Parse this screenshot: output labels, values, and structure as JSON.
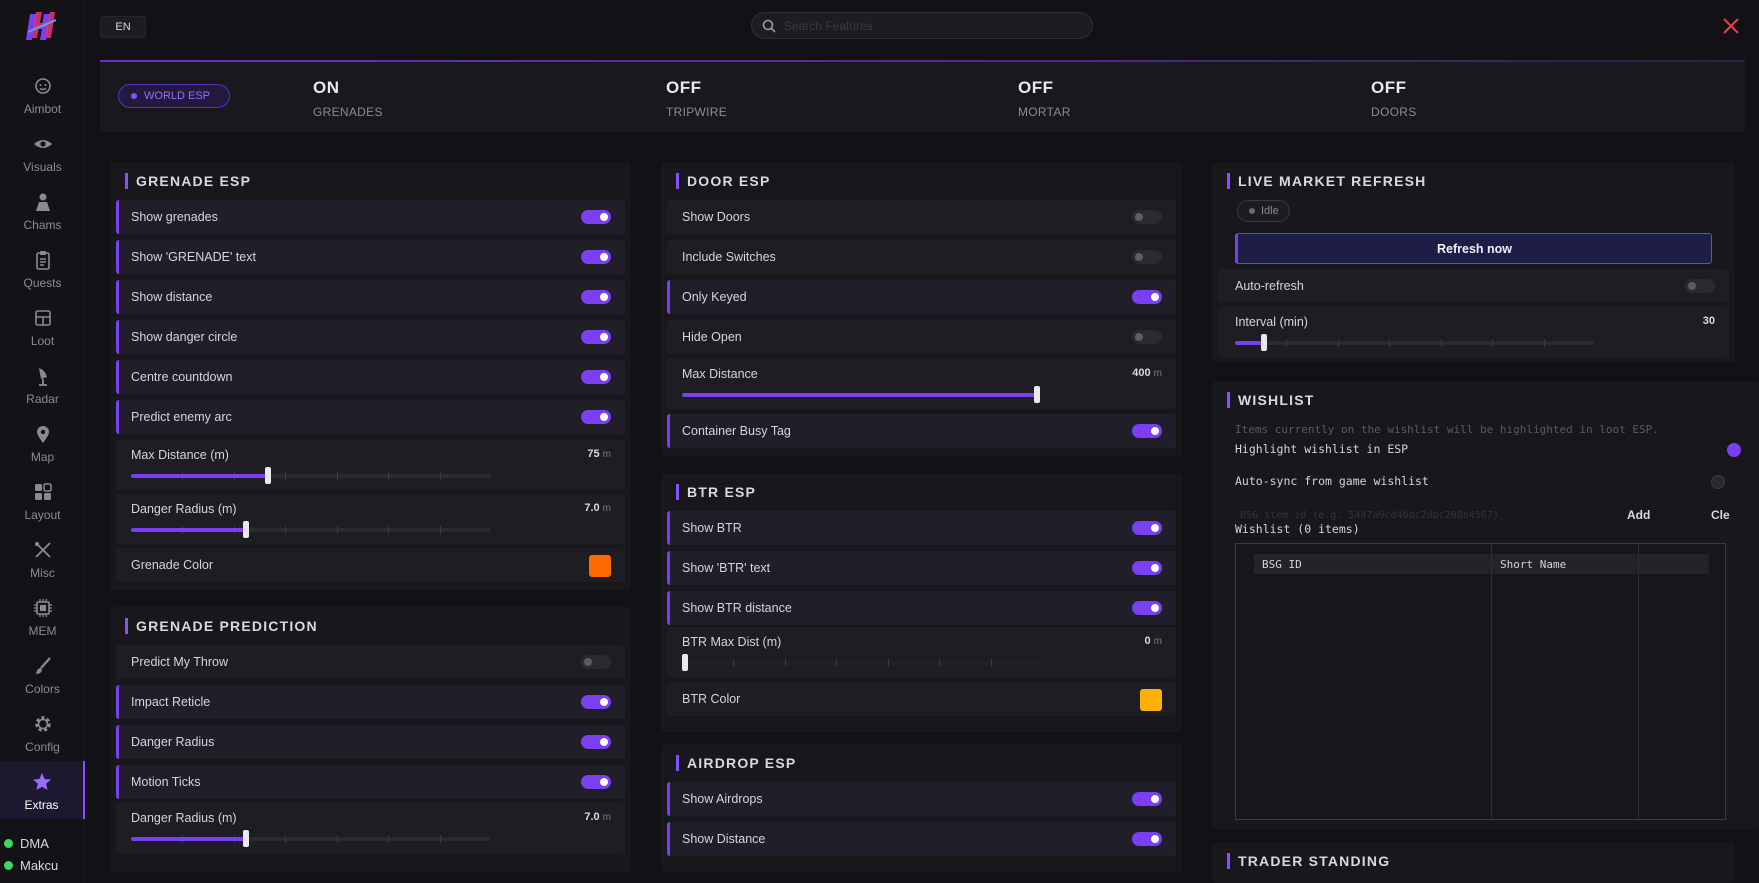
{
  "app": {
    "language": "EN",
    "search_placeholder": "Search Features"
  },
  "sidebar": {
    "items": [
      {
        "label": "Aimbot",
        "icon": "crosshair-icon"
      },
      {
        "label": "Visuals",
        "icon": "eye-icon"
      },
      {
        "label": "Chams",
        "icon": "person-icon"
      },
      {
        "label": "Quests",
        "icon": "clipboard-icon"
      },
      {
        "label": "Loot",
        "icon": "box-icon"
      },
      {
        "label": "Radar",
        "icon": "radar-icon"
      },
      {
        "label": "Map",
        "icon": "map-pin-icon"
      },
      {
        "label": "Layout",
        "icon": "layout-icon"
      },
      {
        "label": "Misc",
        "icon": "tools-icon"
      },
      {
        "label": "MEM",
        "icon": "chip-icon"
      },
      {
        "label": "Colors",
        "icon": "brush-icon"
      },
      {
        "label": "Config",
        "icon": "gear-icon"
      },
      {
        "label": "Extras",
        "icon": "star-icon",
        "active": true
      }
    ],
    "status": [
      {
        "label": "DMA",
        "color": "#3ed664"
      },
      {
        "label": "Makcu",
        "color": "#3ed664"
      }
    ]
  },
  "header": {
    "badge": "WORLD ESP",
    "stats": [
      {
        "value": "ON",
        "label": "GRENADES"
      },
      {
        "value": "OFF",
        "label": "TRIPWIRE"
      },
      {
        "value": "OFF",
        "label": "MORTAR"
      },
      {
        "value": "OFF",
        "label": "DOORS"
      }
    ]
  },
  "grenade_esp": {
    "title": "GRENADE ESP",
    "toggles": [
      {
        "label": "Show grenades",
        "on": true
      },
      {
        "label": "Show 'GRENADE' text",
        "on": true
      },
      {
        "label": "Show distance",
        "on": true
      },
      {
        "label": "Show danger circle",
        "on": true
      },
      {
        "label": "Centre countdown",
        "on": true
      },
      {
        "label": "Predict enemy arc",
        "on": true
      }
    ],
    "max_distance": {
      "label": "Max Distance (m)",
      "value": "75",
      "unit": "m",
      "fraction": 0.38
    },
    "danger_radius": {
      "label": "Danger Radius (m)",
      "value": "7.0",
      "unit": "m",
      "fraction": 0.32
    },
    "color": {
      "label": "Grenade Color",
      "hex": "#ff6a00"
    }
  },
  "grenade_prediction": {
    "title": "GRENADE PREDICTION",
    "toggles": [
      {
        "label": "Predict My Throw",
        "on": false
      },
      {
        "label": "Impact Reticle",
        "on": true
      },
      {
        "label": "Danger Radius",
        "on": true
      },
      {
        "label": "Motion Ticks",
        "on": true
      }
    ],
    "danger_radius": {
      "label": "Danger Radius (m)",
      "value": "7.0",
      "unit": "m",
      "fraction": 0.32
    }
  },
  "door_esp": {
    "title": "DOOR ESP",
    "toggles": [
      {
        "label": "Show Doors",
        "on": false
      },
      {
        "label": "Include Switches",
        "on": false
      },
      {
        "label": "Only Keyed",
        "on": true
      },
      {
        "label": "Hide Open",
        "on": false
      }
    ],
    "max_distance": {
      "label": "Max Distance",
      "value": "400",
      "unit": "m",
      "fraction": 1.0
    },
    "container_busy": {
      "label": "Container Busy Tag",
      "on": true
    }
  },
  "btr_esp": {
    "title": "BTR ESP",
    "toggles": [
      {
        "label": "Show BTR",
        "on": true
      },
      {
        "label": "Show 'BTR' text",
        "on": true
      },
      {
        "label": "Show BTR distance",
        "on": true
      }
    ],
    "max_dist": {
      "label": "BTR Max Dist (m)",
      "value": "0",
      "unit": "m",
      "fraction": 0.0
    },
    "color": {
      "label": "BTR Color",
      "hex": "#ffb000"
    }
  },
  "airdrop_esp": {
    "title": "AIRDROP ESP",
    "toggles": [
      {
        "label": "Show Airdrops",
        "on": true
      },
      {
        "label": "Show Distance",
        "on": true
      }
    ]
  },
  "live_market": {
    "title": "LIVE MARKET REFRESH",
    "status": "Idle",
    "refresh_label": "Refresh now",
    "auto_refresh": {
      "label": "Auto-refresh",
      "on": false
    },
    "interval": {
      "label": "Interval (min)",
      "value": "30",
      "fraction": 0.08
    }
  },
  "wishlist": {
    "title": "WISHLIST",
    "description": "Items currently on the wishlist will be highlighted in loot ESP.",
    "highlight": {
      "label": "Highlight wishlist in ESP",
      "on": true
    },
    "autosync": {
      "label": "Auto-sync from game wishlist",
      "on": false
    },
    "input_placeholder": "BSG item id (e.g. 5447a9cd4bdc2dbc208b4567)",
    "add_label": "Add",
    "clear_label": "Cle",
    "count_label": "Wishlist (0 items)",
    "columns": [
      "BSG ID",
      "Short Name"
    ]
  },
  "trader_standing": {
    "title": "TRADER STANDING"
  }
}
